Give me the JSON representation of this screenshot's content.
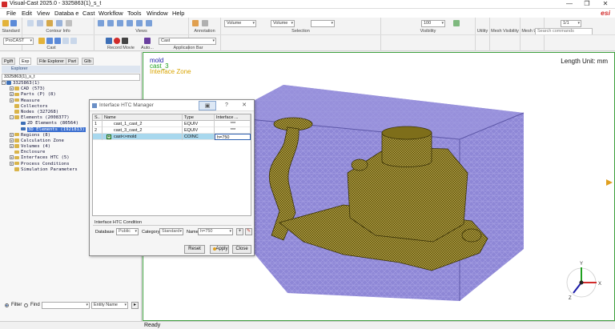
{
  "window": {
    "title": "Visual-Cast 2025.0 - 3325863(1)_s_t",
    "min_glyph": "—",
    "max_glyph": "❐",
    "close_glyph": "✕"
  },
  "menu": {
    "items": [
      "File",
      "Edit",
      "View",
      "Databa e",
      "Cast",
      "Workflow",
      "Tools",
      "Window",
      "Help"
    ],
    "brand": "esi"
  },
  "toolbar": {
    "groups": [
      "Standard",
      "Contour Info",
      "Views",
      "Annotation",
      "Selection",
      "Visibility",
      "Utility",
      "Mesh Visibility",
      "Mesh Uti...",
      "Page",
      "Cast",
      "Record Movie",
      "Auto...",
      "Application Bar"
    ],
    "search_placeholder": "Search commands",
    "combo_procast": "ProCAST",
    "combo_volume1": "Volume",
    "combo_volume2": "Volume",
    "combo_100": "100",
    "combo_page": "1/1",
    "combo_cast": "Cast"
  },
  "explorer": {
    "tabs": [
      "PgIft",
      "Exp",
      "File Explorer",
      "Part",
      "GIb"
    ],
    "title": "Explorer",
    "model_combo": "3325863(1)_s_t",
    "tree": [
      {
        "label": "3325863(1)",
        "depth": 0,
        "exp": "-",
        "folder": "blue"
      },
      {
        "label": "CAD (573)",
        "depth": 1,
        "exp": "+",
        "folder": "yellow"
      },
      {
        "label": "Parts (P) (8)",
        "depth": 1,
        "exp": "+",
        "folder": "yellow"
      },
      {
        "label": "Measure",
        "depth": 1,
        "exp": "+",
        "folder": "yellow"
      },
      {
        "label": "Collectors",
        "depth": 1,
        "exp": "",
        "folder": "yellow"
      },
      {
        "label": "Nodes (327268)",
        "depth": 1,
        "exp": "",
        "folder": "yellow"
      },
      {
        "label": "Elements (2008377)",
        "depth": 1,
        "exp": "-",
        "folder": "yellow"
      },
      {
        "label": "2D Elements (80564)",
        "depth": 2,
        "exp": "",
        "folder": "blue"
      },
      {
        "label": "3D Elements (1921813)",
        "depth": 2,
        "exp": "",
        "folder": "blue",
        "selected": true
      },
      {
        "label": "Regions (8)",
        "depth": 1,
        "exp": "+",
        "folder": "yellow"
      },
      {
        "label": "Calculation Zone",
        "depth": 1,
        "exp": "+",
        "folder": "yellow"
      },
      {
        "label": "Volumes (4)",
        "depth": 1,
        "exp": "+",
        "folder": "yellow"
      },
      {
        "label": "Enclosure",
        "depth": 1,
        "exp": "",
        "folder": "yellow"
      },
      {
        "label": "Interfaces HTC (5)",
        "depth": 1,
        "exp": "+",
        "folder": "yellow"
      },
      {
        "label": "Process Conditions",
        "depth": 1,
        "exp": "+",
        "folder": "yellow"
      },
      {
        "label": "Simulation Parameters",
        "depth": 1,
        "exp": "",
        "folder": "yellow"
      }
    ],
    "filter_label": "Filter",
    "find_label": "Find",
    "filter_combo": "",
    "entity_combo": "Entity Name"
  },
  "viewport": {
    "legend": [
      "mold",
      "cast_3",
      "Interface Zone"
    ],
    "unit_label": "Length Unit: mm",
    "colors": {
      "mold": "#1a1aa8",
      "cast": "#20a020",
      "interface": "#d9a400",
      "mesh_box": "#8e87d6",
      "part": "#6b5d12"
    },
    "axis_labels": [
      "X",
      "Y",
      "Z"
    ]
  },
  "dialog": {
    "title": "Interface HTC Manager",
    "help_glyph": "?",
    "close_glyph": "✕",
    "columns": [
      "S..",
      "Name",
      "Type",
      "Interface ..."
    ],
    "rows": [
      {
        "s": "1",
        "name": "cast_1_cast_2",
        "type": "EQUIV",
        "value": "***"
      },
      {
        "s": "2",
        "name": "cast_3_cast_2",
        "type": "EQUIV",
        "value": "***"
      },
      {
        "s": "",
        "name": "cast<>mold",
        "type": "COINC",
        "value": "h=750",
        "selected": true
      }
    ],
    "condition_label": "Interface HTC Condition",
    "database_label": "Database",
    "database_value": "Public",
    "category_label": "Category",
    "category_value": "Standard",
    "name_label": "Name",
    "name_value": "h=750",
    "reset": "Reset",
    "apply": "Apply",
    "close": "Close"
  },
  "status": {
    "text": "Ready"
  }
}
